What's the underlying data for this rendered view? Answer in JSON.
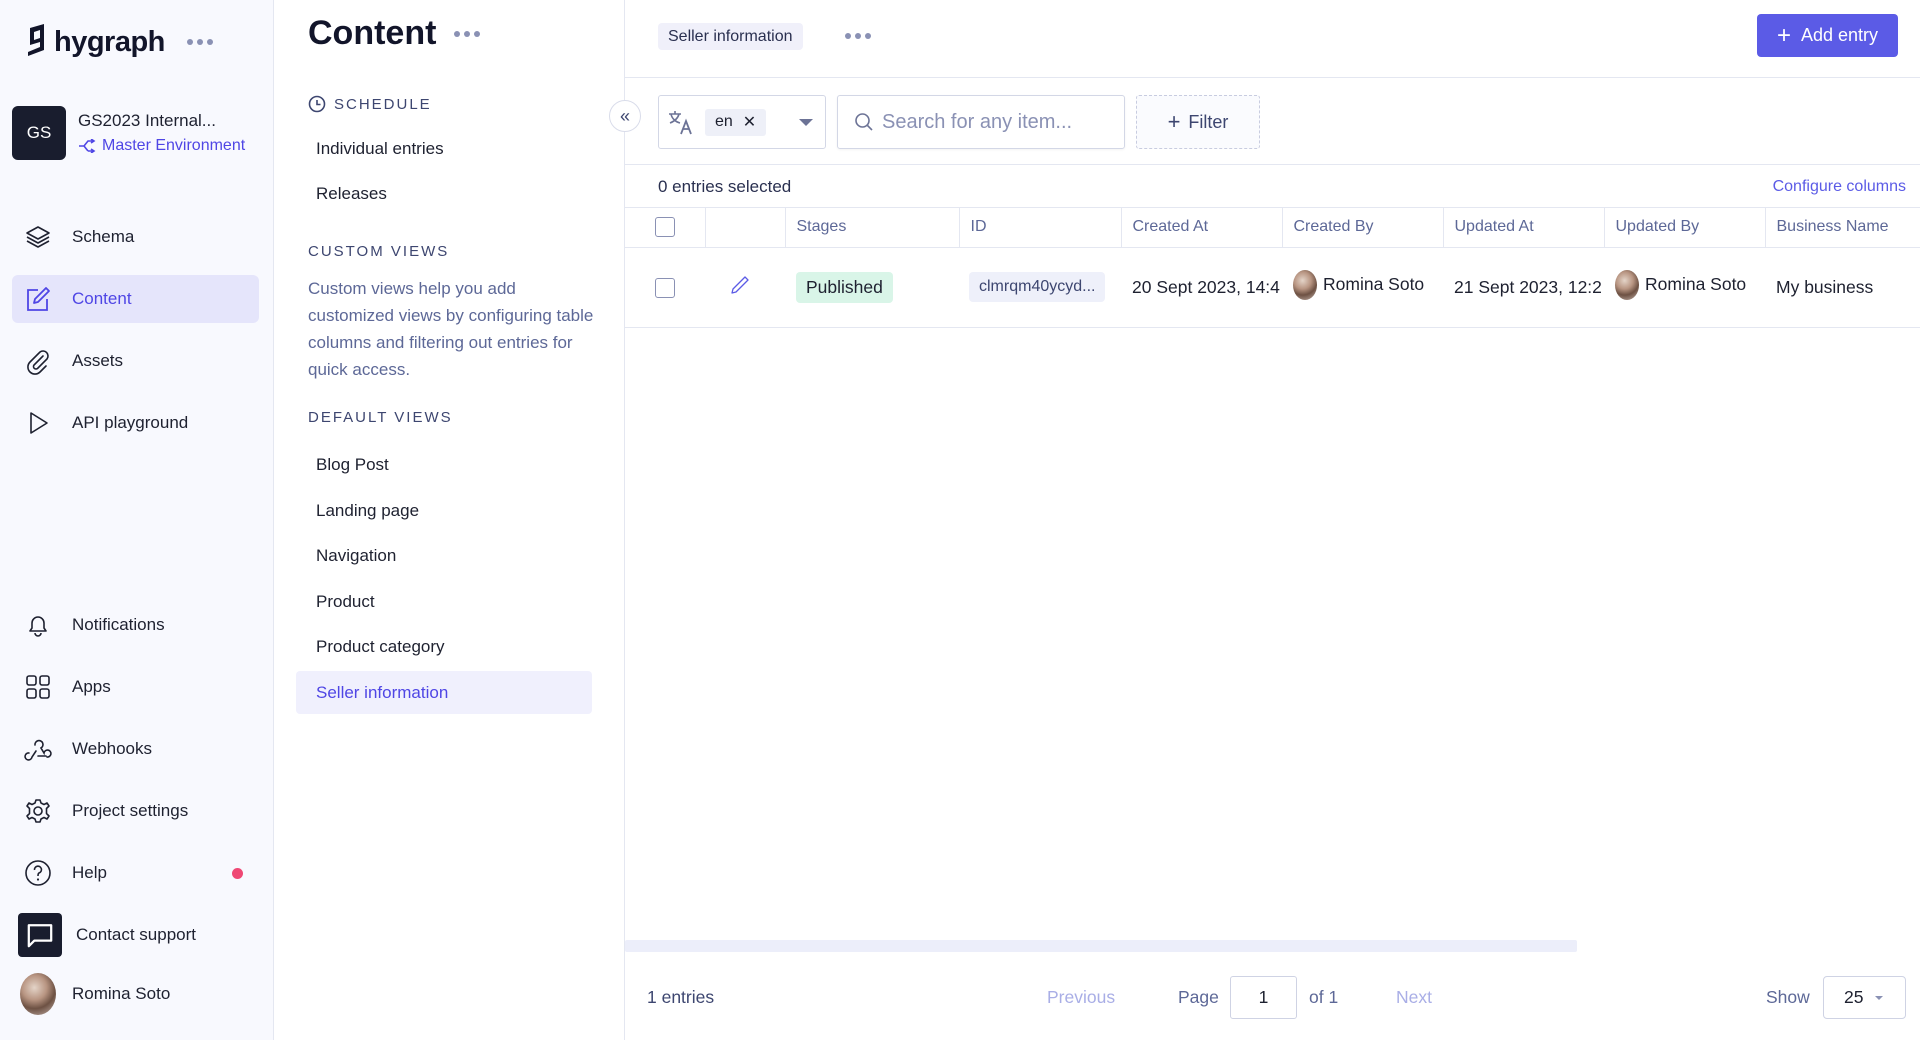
{
  "app": {
    "brand": "hygraph"
  },
  "project": {
    "initials": "GS",
    "name": "GS2023 Internal...",
    "environment": "Master Environment"
  },
  "nav": {
    "top": [
      {
        "label": "Schema",
        "icon": "layers-icon"
      },
      {
        "label": "Content",
        "icon": "edit-icon",
        "active": true
      },
      {
        "label": "Assets",
        "icon": "paperclip-icon"
      },
      {
        "label": "API playground",
        "icon": "play-icon"
      }
    ],
    "bottom": [
      {
        "label": "Notifications",
        "icon": "bell-icon"
      },
      {
        "label": "Apps",
        "icon": "grid-icon"
      },
      {
        "label": "Webhooks",
        "icon": "webhook-icon"
      },
      {
        "label": "Project settings",
        "icon": "gear-icon"
      },
      {
        "label": "Help",
        "icon": "help-icon",
        "has_notification": true
      },
      {
        "label": "Contact support",
        "icon": "chat-icon"
      },
      {
        "label": "Romina Soto",
        "icon": "avatar"
      }
    ],
    "accent": "#4f46e5"
  },
  "content_panel": {
    "title": "Content",
    "schedule": {
      "label": "SCHEDULE",
      "items": [
        "Individual entries",
        "Releases"
      ]
    },
    "custom_views": {
      "label": "CUSTOM VIEWS",
      "description": "Custom views help you add customized views by configuring table columns and filtering out entries for quick access."
    },
    "default_views": {
      "label": "DEFAULT VIEWS",
      "items": [
        "Blog Post",
        "Landing page",
        "Navigation",
        "Product",
        "Product category",
        "Seller information"
      ],
      "active": "Seller information"
    }
  },
  "main": {
    "view_name": "Seller information",
    "add_entry_label": "Add entry",
    "locale": "en",
    "search_placeholder": "Search for any item...",
    "filter_label": "Filter",
    "selected_count": "0 entries selected",
    "configure_columns": "Configure columns",
    "columns": [
      "",
      "",
      "Stages",
      "ID",
      "Created At",
      "Created By",
      "Updated At",
      "Updated By",
      "Business Name"
    ],
    "rows": [
      {
        "stage": "Published",
        "id": "clmrqm40ycyd...",
        "created_at": "20 Sept 2023, 14:4",
        "created_by": "Romina Soto",
        "updated_at": "21 Sept 2023, 12:2",
        "updated_by": "Romina Soto",
        "business_name": "My business"
      }
    ],
    "footer": {
      "entries": "1 entries",
      "previous": "Previous",
      "page_label": "Page",
      "page": "1",
      "of": "of 1",
      "next": "Next",
      "show_label": "Show",
      "page_size": "25"
    }
  }
}
